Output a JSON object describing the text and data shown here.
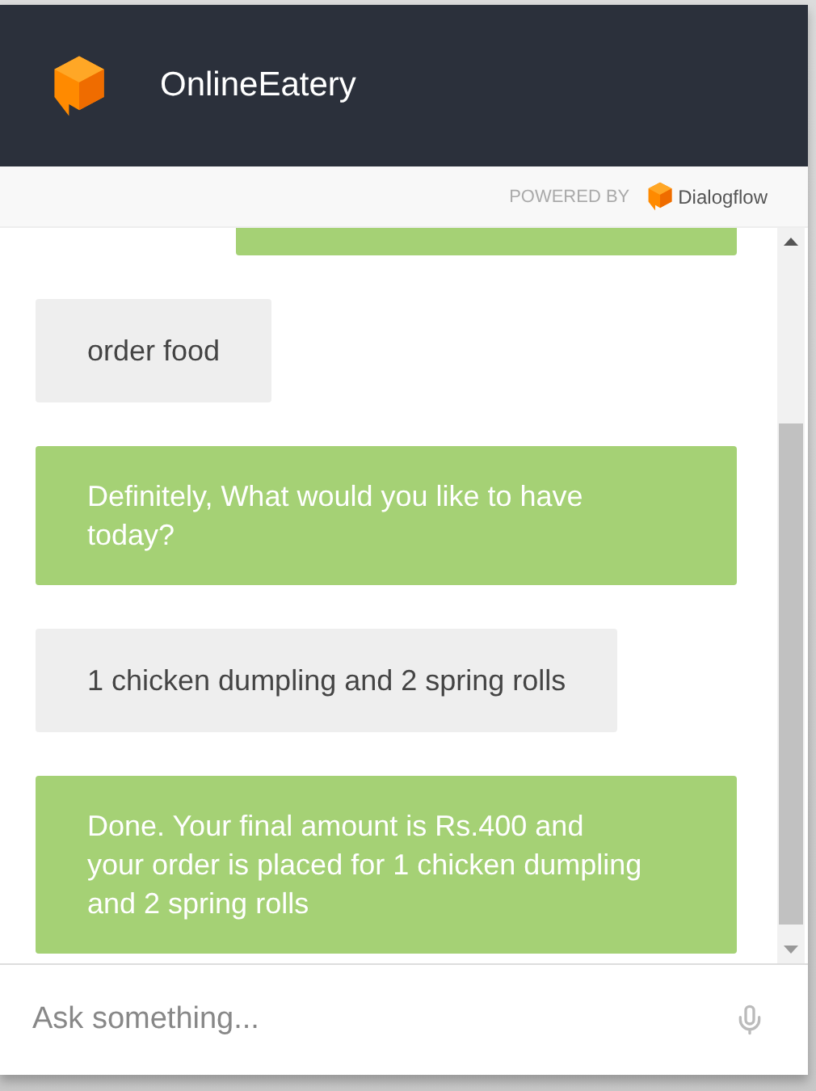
{
  "header": {
    "title": "OnlineEatery"
  },
  "powered_by": {
    "label": "POWERED BY",
    "brand": "Dialogflow"
  },
  "messages": [
    {
      "kind": "cut"
    },
    {
      "kind": "user",
      "text": "order food"
    },
    {
      "kind": "bot",
      "text": "Definitely, What would you like to have today?"
    },
    {
      "kind": "user",
      "text": "1 chicken dumpling and 2 spring rolls"
    },
    {
      "kind": "bot",
      "text": "Done. Your final amount is Rs.400 and your order is placed for 1 chicken dumpling and 2 spring rolls"
    }
  ],
  "input": {
    "placeholder": "Ask something..."
  }
}
